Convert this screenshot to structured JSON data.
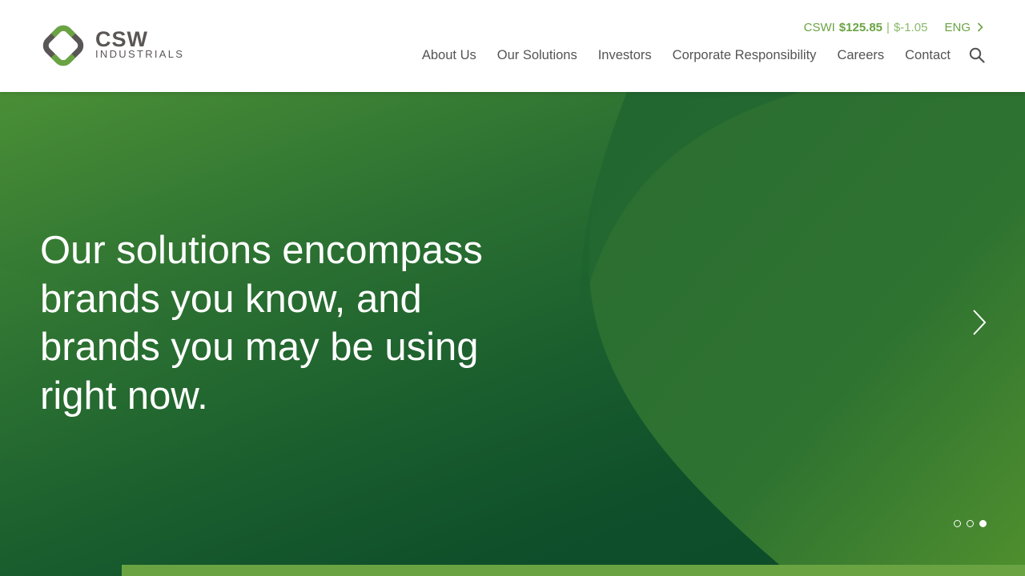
{
  "header": {
    "logo": {
      "line1": "CSW",
      "line2": "INDUSTRIALS",
      "icon": "csw-diamond-logo-icon"
    },
    "ticker": {
      "symbol": "CSWI",
      "price": "$125.85",
      "separator": "|",
      "change": "$-1.05"
    },
    "language": {
      "label": "ENG",
      "icon": "chevron-right-icon"
    },
    "nav": [
      {
        "label": "About Us"
      },
      {
        "label": "Our Solutions"
      },
      {
        "label": "Investors"
      },
      {
        "label": "Corporate Responsibility"
      },
      {
        "label": "Careers"
      },
      {
        "label": "Contact"
      }
    ],
    "search_icon": "search-icon"
  },
  "hero": {
    "headline": "Our solutions encompass brands you know, and brands you may be using right now.",
    "next_icon": "chevron-right-icon",
    "slides": {
      "count": 3,
      "active_index": 2
    }
  },
  "colors": {
    "brand_green": "#6aa442",
    "brand_gray": "#5b5656",
    "hero_dark_green": "#0d4a29",
    "hero_light_green": "#4a8f36"
  }
}
